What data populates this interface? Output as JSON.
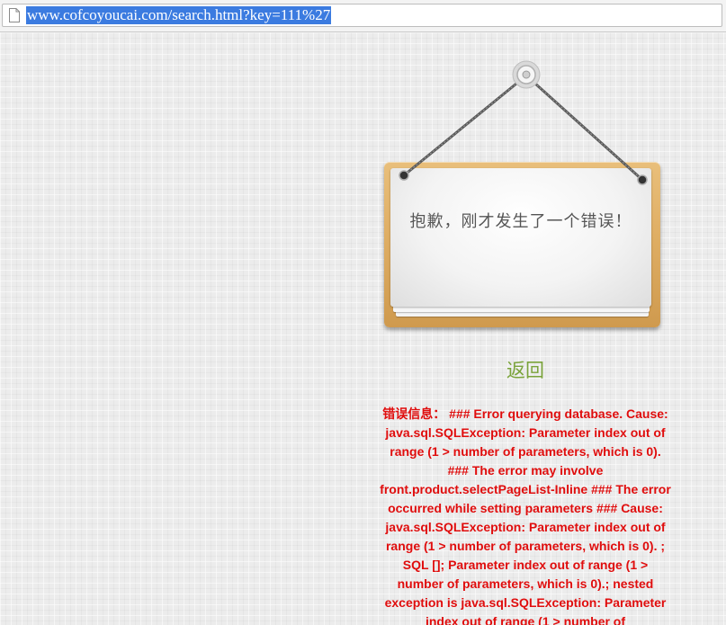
{
  "browser": {
    "url": "www.cofcoyoucai.com/search.html?key=111%27",
    "page_icon": "page-icon"
  },
  "sign": {
    "message": "抱歉，刚才发生了一个错误！"
  },
  "back_link": {
    "label": "返回"
  },
  "error": {
    "label": "错误信息：",
    "text": " ### Error querying database. Cause: java.sql.SQLException: Parameter index out of range (1 > number of parameters, which is 0). ### The error may involve front.product.selectPageList-Inline ### The error occurred while setting parameters ### Cause: java.sql.SQLException: Parameter index out of range (1 > number of parameters, which is 0). ; SQL []; Parameter index out of range (1 > number of parameters, which is 0).; nested exception is java.sql.SQLException: Parameter index out of range (1 > number of"
  },
  "colors": {
    "error_text": "#e00d0d",
    "back_link": "#7aa33a",
    "url_highlight": "#3b7be0"
  }
}
